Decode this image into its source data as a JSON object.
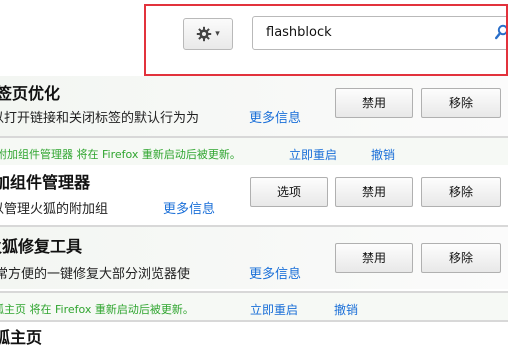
{
  "toolbar": {
    "gear_icon": "gear-icon",
    "dropdown_arrow": "▾",
    "search_value": "flashblock",
    "search_icon": "search-icon"
  },
  "addons": [
    {
      "title": "标签页优化",
      "description": "可以打开链接和关闭标签的默认行为为",
      "more_info": "更多信息",
      "buttons": [
        "禁用",
        "移除"
      ]
    },
    {
      "title": "附加组件管理器",
      "description": "可以管理火狐的附加组",
      "more_info": "更多信息",
      "buttons": [
        "选项",
        "禁用",
        "移除"
      ]
    },
    {
      "title": "火狐修复工具",
      "description": "非常方便的一键修复大部分浏览器使",
      "more_info": "更多信息",
      "buttons": [
        "禁用",
        "移除"
      ]
    },
    {
      "title": "火狐主页",
      "description": "",
      "more_info": "",
      "buttons": []
    }
  ],
  "notices": [
    {
      "text": "附加组件管理器 将在 Firefox 重新启动后被更新。",
      "restart": "立即重启",
      "undo": "撤销"
    },
    {
      "text": "火狐主页 将在 Firefox 重新启动后被更新。",
      "restart": "立即重启",
      "undo": "撤销"
    }
  ],
  "colors": {
    "highlight_border": "#e2323c",
    "link": "#1a6fd8",
    "notice_text": "#2fa52f",
    "notice_row_bg": "#f6f9f5"
  }
}
